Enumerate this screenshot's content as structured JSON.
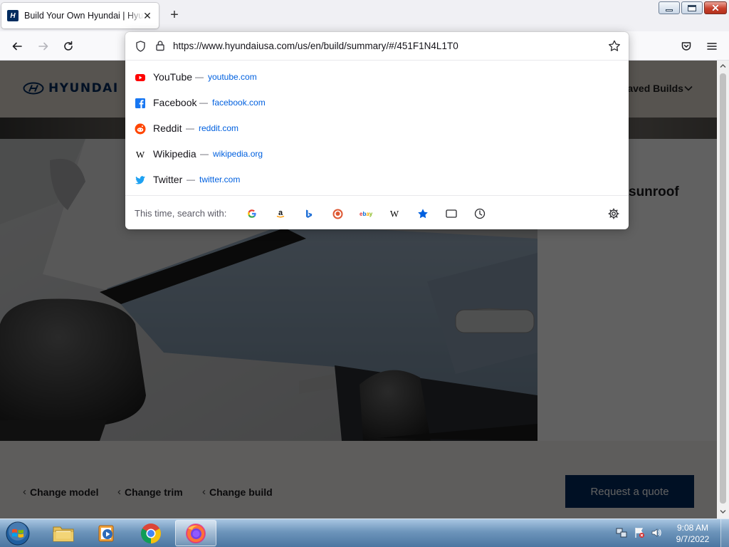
{
  "window": {
    "tab_title": "Build Your Own Hyundai | Hyundai USA",
    "tab_favicon": "hyundai-logo-icon",
    "new_tab_label": "+"
  },
  "navbar": {
    "url": "https://www.hyundaiusa.com/us/en/build/summary/#/451F1N4L1T0"
  },
  "suggestions": [
    {
      "name": "YouTube",
      "domain": "youtube.com",
      "icon": "youtube-icon",
      "color": "#ff0000"
    },
    {
      "name": "Facebook",
      "domain": "facebook.com",
      "icon": "facebook-icon",
      "color": "#1877f2"
    },
    {
      "name": "Reddit",
      "domain": "reddit.com",
      "icon": "reddit-icon",
      "color": "#ff4500"
    },
    {
      "name": "Wikipedia",
      "domain": "wikipedia.org",
      "icon": "wikipedia-icon",
      "color": "#000000"
    },
    {
      "name": "Twitter",
      "domain": "twitter.com",
      "icon": "twitter-icon",
      "color": "#1da1f2"
    }
  ],
  "search_oneoffs": {
    "label": "This time, search with:",
    "engines": [
      "google-icon",
      "amazon-icon",
      "bing-icon",
      "duckduckgo-icon",
      "ebay-icon",
      "wikipedia-icon",
      "bookmarks-icon",
      "tabs-icon",
      "history-icon"
    ],
    "settings_icon": "gear-icon"
  },
  "page": {
    "brand": "HYUNDAI",
    "saved_builds": "Saved Builds",
    "feature_title": "sunroof",
    "footer_links": [
      "Change model",
      "Change trim",
      "Change build"
    ],
    "cta": "Request a quote",
    "brand_color": "#002c5f"
  },
  "taskbar": {
    "time": "9:08 AM",
    "date": "9/7/2022",
    "apps": [
      "file-explorer-icon",
      "media-player-icon",
      "chrome-icon",
      "firefox-icon"
    ]
  }
}
